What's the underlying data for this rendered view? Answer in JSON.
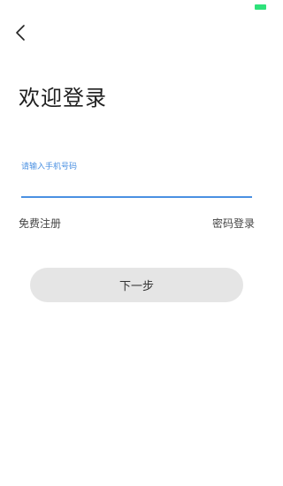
{
  "status_bar": {
    "battery_icon": "battery-icon",
    "battery_color": "#2ee27a"
  },
  "header": {
    "back_icon": "chevron-left-icon"
  },
  "title": "欢迎登录",
  "phone_field": {
    "label": "请输入手机号码",
    "value": "",
    "accent_color": "#4a90e2"
  },
  "links": {
    "register": "免费注册",
    "password_login": "密码登录"
  },
  "next_button": {
    "label": "下一步",
    "background": "#e5e5e5"
  }
}
